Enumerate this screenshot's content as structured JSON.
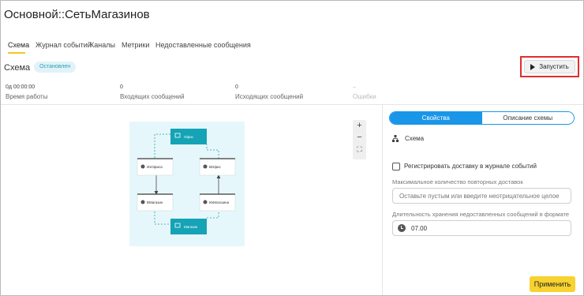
{
  "window": {
    "title": "Основной::СетьМагазинов"
  },
  "tabs": [
    {
      "label": "Схема",
      "active": true
    },
    {
      "label": "Журнал событий"
    },
    {
      "label": "Каналы"
    },
    {
      "label": "Метрики"
    },
    {
      "label": "Недоставленные сообщения"
    }
  ],
  "section": {
    "title": "Схема",
    "status": "Остановлен"
  },
  "toolbar": {
    "run_label": "Запустить",
    "run_icon": "play-icon"
  },
  "stats": [
    {
      "value": "0д 00:00:00",
      "label": "Время работы"
    },
    {
      "value": "0",
      "label": "Входящих сообщений"
    },
    {
      "value": "0",
      "label": "Исходящих сообщений"
    },
    {
      "value": "–",
      "label": "Ошибки"
    }
  ],
  "diagram": {
    "nodes": {
      "office": "Офис",
      "from_office": "ИзОфиса",
      "to_office": "ВОфис",
      "to_shop": "ВМагазин",
      "from_shop": "ИзМагазина",
      "shop": "Магазин"
    },
    "colors": {
      "endpoint": "#15a3b6",
      "background": "#e6f7fb"
    }
  },
  "zoom": {
    "in": "+",
    "out": "−",
    "fit": "⛶"
  },
  "panel": {
    "tabs": [
      "Свойства",
      "Описание схемы"
    ],
    "schema_label": "Схема",
    "register_delivery": "Регистрировать доставку в журнале событий",
    "max_retries_label": "Максимальное количество повторных доставок",
    "max_retries_placeholder": "Оставьте пустым или введите неотрицательное целое",
    "retention_label": "Длительность хранения недоставленных сообщений в формате",
    "retention_value": "07.00",
    "apply_label": "Применить"
  },
  "colors": {
    "accent": "#1a96e8",
    "tab_underline": "#f3c623",
    "apply": "#f7d230",
    "highlight": "#e32d2d"
  }
}
